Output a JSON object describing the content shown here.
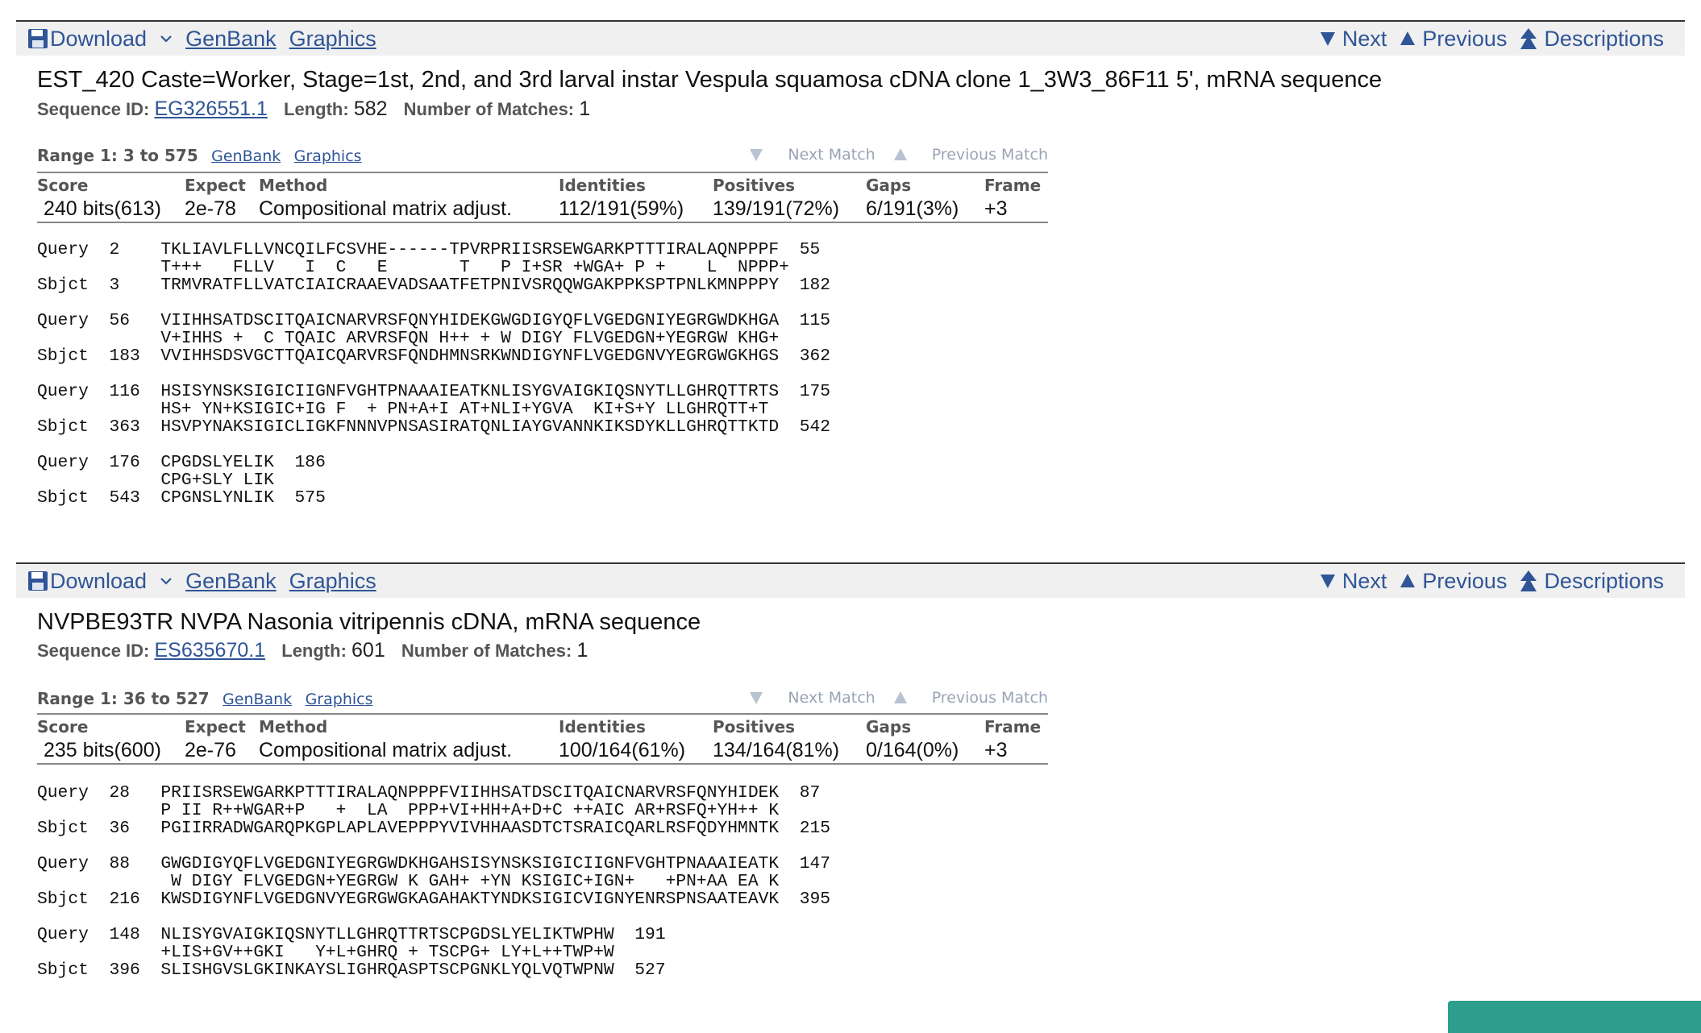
{
  "toolbar": {
    "download_label": "Download",
    "genbank_label": "GenBank",
    "graphics_label": "Graphics",
    "next_label": "Next",
    "previous_label": "Previous",
    "descriptions_label": "Descriptions"
  },
  "labels": {
    "sequence_id": "Sequence ID:",
    "length": "Length:",
    "number_of_matches": "Number of Matches:",
    "next_match": "Next Match",
    "previous_match": "Previous Match",
    "range_genbank": "GenBank",
    "range_graphics": "Graphics"
  },
  "score_columns": [
    "Score",
    "Expect",
    "Method",
    "Identities",
    "Positives",
    "Gaps",
    "Frame"
  ],
  "results": [
    {
      "title": "EST_420 Caste=Worker, Stage=1st, 2nd, and 3rd larval instar Vespula squamosa cDNA clone 1_3W3_86F11 5', mRNA sequence",
      "sequence_id": "EG326551.1",
      "length": "582",
      "matches": "1",
      "range": "Range 1: 3 to 575",
      "score": {
        "score": "240 bits(613)",
        "expect": "2e-78",
        "method": "Compositional matrix adjust.",
        "identities": "112/191(59%)",
        "positives": "139/191(72%)",
        "gaps": "6/191(3%)",
        "frame": "+3"
      },
      "alignment": "Query  2    TKLIAVLFLLVNCQILFCSVHE------TPVRPRIISRSEWGARKPTTTIRALAQNPPPF  55\n            T+++   FLLV   I  C   E       T   P I+SR +WGA+ P +    L  NPPP+\nSbjct  3    TRMVRATFLLVATCIAICRAAEVADSAATFETPNIVSRQQWGAKPPKSPTPNLKMNPPPY  182\n\nQuery  56   VIIHHSATDSCITQAICNARVRSFQNYHIDEKGWGDIGYQFLVGEDGNIYEGRGWDKHGA  115\n            V+IHHS +  C TQAIC ARVRSFQN H++ + W DIGY FLVGEDGN+YEGRGW KHG+\nSbjct  183  VVIHHSDSVGCTTQAICQARVRSFQNDHMNSRKWNDIGYNFLVGEDGNVYEGRGWGKHGS  362\n\nQuery  116  HSISYNSKSIGICIIGNFVGHTPNAAAIEATKNLISYGVAIGKIQSNYTLLGHRQTTRTS  175\n            HS+ YN+KSIGIC+IG F  + PN+A+I AT+NLI+YGVA  KI+S+Y LLGHRQTT+T\nSbjct  363  HSVPYNAKSIGICLIGKFNNNVPNSASIRATQNLIAYGVANNKIKSDYKLLGHRQTTKTD  542\n\nQuery  176  CPGDSLYELIK  186\n            CPG+SLY LIK\nSbjct  543  CPGNSLYNLIK  575"
    },
    {
      "title": "NVPBE93TR NVPA Nasonia vitripennis cDNA, mRNA sequence",
      "sequence_id": "ES635670.1",
      "length": "601",
      "matches": "1",
      "range": "Range 1: 36 to 527",
      "score": {
        "score": "235 bits(600)",
        "expect": "2e-76",
        "method": "Compositional matrix adjust.",
        "identities": "100/164(61%)",
        "positives": "134/164(81%)",
        "gaps": "0/164(0%)",
        "frame": "+3"
      },
      "alignment": "Query  28   PRIISRSEWGARKPTTTIRALAQNPPPFVIIHHSATDSCITQAICNARVRSFQNYHIDEK  87\n            P II R++WGAR+P   +  LA  PPP+VI+HH+A+D+C ++AIC AR+RSFQ+YH++ K\nSbjct  36   PGIIRRADWGARQPKGPLAPLAVEPPPYVIVHHAASDTCTSRAICQARLRSFQDYHMNTK  215\n\nQuery  88   GWGDIGYQFLVGEDGNIYEGRGWDKHGAHSISYNSKSIGICIIGNFVGHTPNAAAIEATK  147\n             W DIGY FLVGEDGN+YEGRGW K GAH+ +YN KSIGIC+IGN+   +PN+AA EA K\nSbjct  216  KWSDIGYNFLVGEDGNVYEGRGWGKAGAHAKTYNDKSIGICVIGNYENRSPNSAATEAVK  395\n\nQuery  148  NLISYGVAIGKIQSNYTLLGHRQTTRTSCPGDSLYELIKTWPHW  191\n            +LIS+GV++GKI   Y+L+GHRQ + TSCPG+ LY+L++TWP+W\nSbjct  396  SLISHGVSLGKINKAYSLIGHRQASPTSCPGNKLYQLVQTWPNW  527"
    }
  ]
}
